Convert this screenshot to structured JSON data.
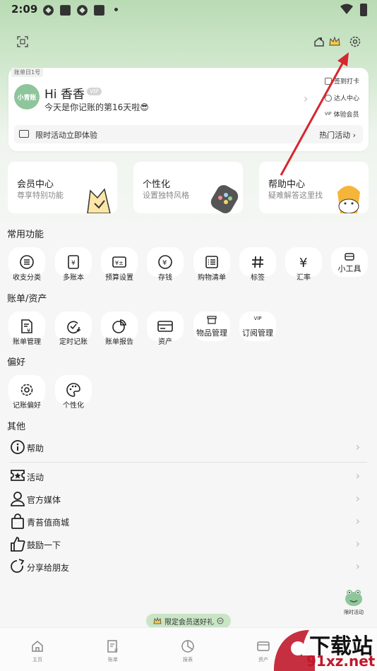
{
  "status_bar": {
    "time": "2:09"
  },
  "account": {
    "tag": "账单日1号",
    "avatar_text": "小青账",
    "greeting": "Hi 香香",
    "vip_badge": "VIP",
    "days_text": "今天是你记账的第16天啦😎",
    "quick_links": [
      "签到打卡",
      "达人中心",
      "体验会员"
    ],
    "promo_left": "限时活动立即体验",
    "promo_right": "热门活动 ›"
  },
  "features": [
    {
      "title": "会员中心",
      "subtitle": "尊享特别功能"
    },
    {
      "title": "个性化",
      "subtitle": "设置独特风格"
    },
    {
      "title": "帮助中心",
      "subtitle": "疑难解答这里找"
    }
  ],
  "sections": {
    "common": {
      "title": "常用功能",
      "items": [
        "收支分类",
        "多账本",
        "预算设置",
        "存钱",
        "购物清单",
        "标签",
        "汇率",
        "小工具"
      ]
    },
    "bills": {
      "title": "账单/资产",
      "items": [
        "账单管理",
        "定时记账",
        "账单报告",
        "资产",
        "物品管理",
        "订阅管理"
      ]
    },
    "prefs": {
      "title": "偏好",
      "items": [
        "记账偏好",
        "个性化"
      ]
    },
    "other": {
      "title": "其他",
      "items": [
        "帮助",
        "活动",
        "官方媒体",
        "青苔值商城",
        "鼓励一下",
        "分享给朋友"
      ]
    }
  },
  "float_promo": "限定会员送好礼",
  "side_badge": "限时活动",
  "tabs": [
    "主页",
    "账单",
    "报表",
    "资产"
  ],
  "watermark": {
    "brand": "下载站",
    "url": "91xz.net"
  },
  "colors": {
    "accent_green": "#8ec59a",
    "arrow_red": "#d6262e",
    "header_green": "#b9dbb4"
  }
}
